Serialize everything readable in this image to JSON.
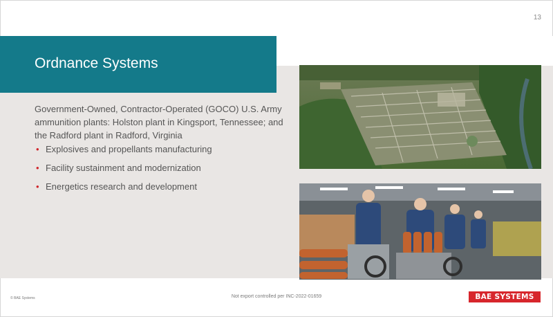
{
  "slide": {
    "page_number": "13",
    "title": "Ordnance Systems",
    "intro": "Government-Owned, Contractor-Operated (GOCO) U.S. Army ammunition plants: Holston plant in Kingsport, Tennessee; and the Radford plant in Radford, Virginia",
    "bullets": [
      "Explosives and propellants manufacturing",
      "Facility sustainment and modernization",
      "Energetics research and development"
    ]
  },
  "footer": {
    "copyright": "© BAE Systems",
    "export_notice": "Not export controlled per INC-2022-01659",
    "logo_text": "BAE SYSTEMS"
  },
  "colors": {
    "title_bar": "#147a8a",
    "content_band": "#e9e6e4",
    "bullet": "#d0262c",
    "logo": "#d7262c"
  }
}
